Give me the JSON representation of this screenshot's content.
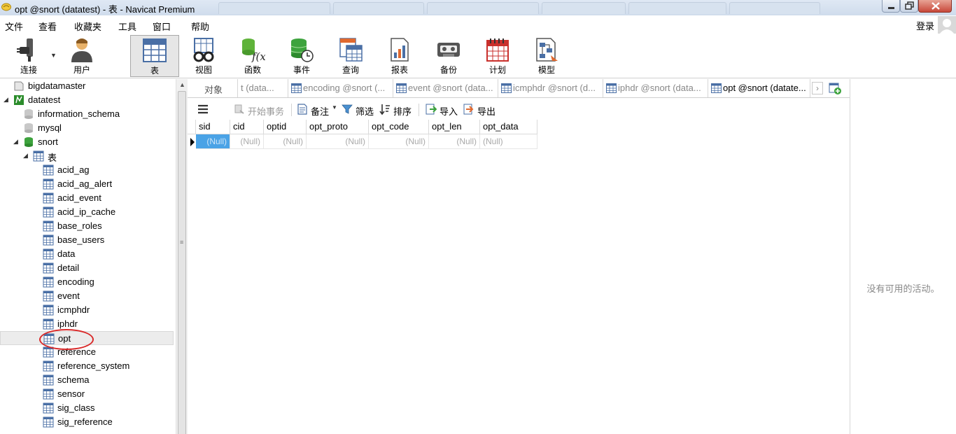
{
  "window": {
    "title": "opt @snort (datatest) - 表 - Navicat Premium"
  },
  "menu": {
    "items": [
      "文件",
      "查看",
      "收藏夹",
      "工具",
      "窗口",
      "帮助"
    ],
    "login": "登录"
  },
  "toolbar": {
    "buttons": [
      {
        "label": "连接",
        "icon": "plug-icon"
      },
      {
        "label": "用户",
        "icon": "user-icon"
      },
      {
        "label": "表",
        "icon": "table-icon",
        "active": true
      },
      {
        "label": "视图",
        "icon": "glasses-icon"
      },
      {
        "label": "函数",
        "icon": "function-icon"
      },
      {
        "label": "事件",
        "icon": "event-clock-icon"
      },
      {
        "label": "查询",
        "icon": "query-icon"
      },
      {
        "label": "报表",
        "icon": "report-icon"
      },
      {
        "label": "备份",
        "icon": "backup-icon"
      },
      {
        "label": "计划",
        "icon": "calendar-icon"
      },
      {
        "label": "模型",
        "icon": "model-icon"
      }
    ]
  },
  "tree": {
    "connections": [
      {
        "label": "bigdatamaster"
      },
      {
        "label": "datatest"
      }
    ],
    "databases": [
      "information_schema",
      "mysql",
      "snort"
    ],
    "tables_folder": "表",
    "tables": [
      "acid_ag",
      "acid_ag_alert",
      "acid_event",
      "acid_ip_cache",
      "base_roles",
      "base_users",
      "data",
      "detail",
      "encoding",
      "event",
      "icmphdr",
      "iphdr",
      "opt",
      "reference",
      "reference_system",
      "schema",
      "sensor",
      "sig_class",
      "sig_reference"
    ],
    "selected_table": "opt"
  },
  "tabs": {
    "objects": "对象",
    "items": [
      {
        "label": "t (data...",
        "active": false
      },
      {
        "label": "encoding @snort (...",
        "active": false
      },
      {
        "label": "event @snort (data...",
        "active": false
      },
      {
        "label": "icmphdr @snort (d...",
        "active": false
      },
      {
        "label": "iphdr @snort (data...",
        "active": false
      },
      {
        "label": "opt @snort (datate...",
        "active": true
      }
    ]
  },
  "data_toolbar": {
    "begin_transaction": "开始事务",
    "comment": "备注",
    "filter": "筛选",
    "sort": "排序",
    "import": "导入",
    "export": "导出"
  },
  "grid": {
    "columns": [
      "sid",
      "cid",
      "optid",
      "opt_proto",
      "opt_code",
      "opt_len",
      "opt_data"
    ],
    "rows": [
      [
        "(Null)",
        "(Null)",
        "(Null)",
        "(Null)",
        "(Null)",
        "(Null)",
        "(Null)"
      ]
    ]
  },
  "right_panel": {
    "empty_text": "没有可用的活动。"
  },
  "colors": {
    "selected_cell": "#4aa3e6",
    "annotation": "#d92a2a",
    "db_green": "#3da33d",
    "table_icon_blue": "#4a6fa5"
  }
}
